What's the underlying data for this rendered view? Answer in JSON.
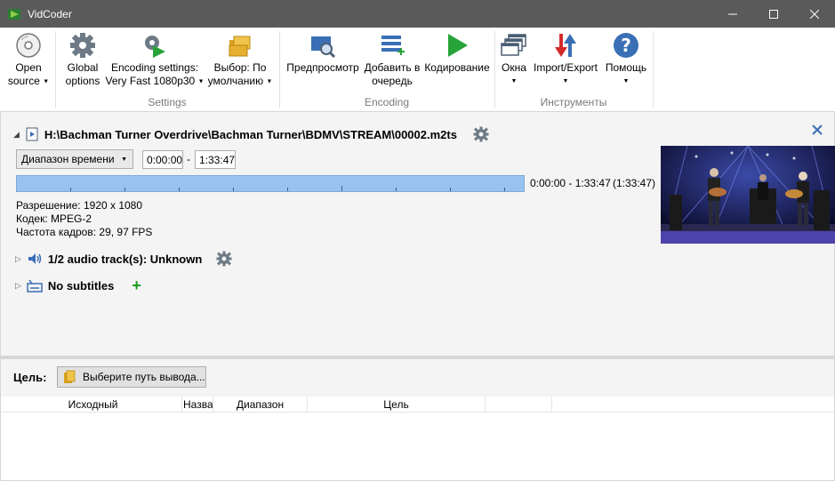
{
  "window": {
    "title": "VidCoder"
  },
  "ribbon": {
    "open_source": [
      "Open",
      "source"
    ],
    "global_options": [
      "Global",
      "options"
    ],
    "encoding_settings": [
      "Encoding settings:",
      "Very Fast 1080p30"
    ],
    "selection": [
      "Выбор: По",
      "умолчанию"
    ],
    "preview": "Предпросмотр",
    "add_to_queue": [
      "Добавить в",
      "очередь"
    ],
    "encode": "Кодирование",
    "windows": "Окна",
    "import_export": "Import/Export",
    "help": "Помощь",
    "groups": {
      "settings": "Settings",
      "encoding": "Encoding",
      "tools": "Инструменты"
    }
  },
  "source": {
    "path": "H:\\Bachman Turner Overdrive\\Bachman Turner\\BDMV\\STREAM\\00002.m2ts",
    "range_mode": "Диапазон времени",
    "range_start": "0:00:00",
    "range_dash": "-",
    "range_end": "1:33:47",
    "timeline_range": "0:00:00 - 1:33:47",
    "timeline_duration": "(1:33:47)",
    "resolution": "Разрешение: 1920 x 1080",
    "codec": "Кодек: MPEG-2",
    "framerate": "Частота кадров: 29, 97 FPS",
    "audio": "1/2 audio track(s): Unknown",
    "subtitles": "No subtitles"
  },
  "destination": {
    "label": "Цель:",
    "choose_button": "Выберите путь вывода..."
  },
  "queue": {
    "columns": [
      "Исходный",
      "Назва",
      "Диапазон",
      "Цель"
    ]
  },
  "colors": {
    "accent": "#3a6fb5",
    "timeline": "#99c2ee",
    "titlebar": "#5a5a5a",
    "play": "#27a33a"
  }
}
